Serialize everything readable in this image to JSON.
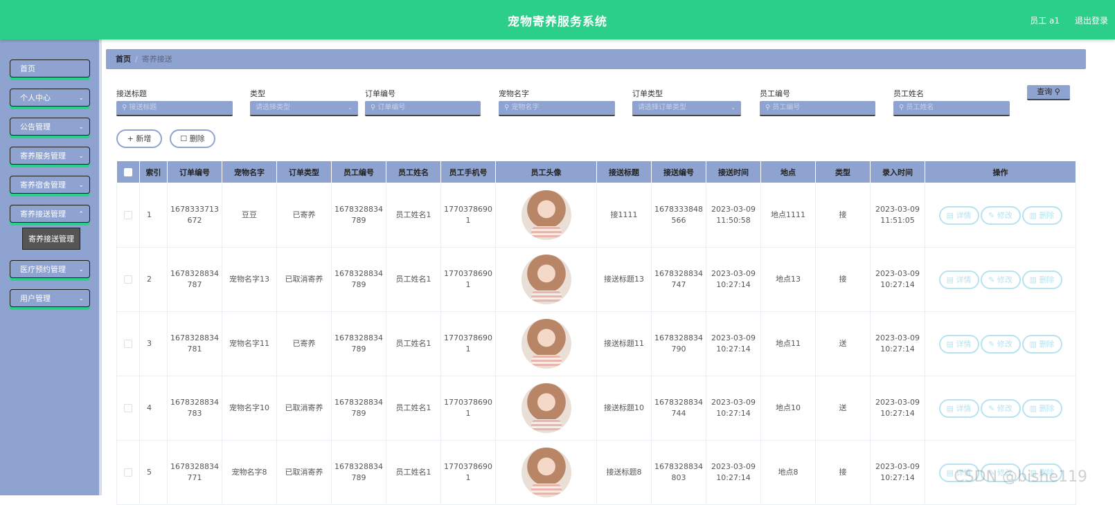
{
  "header": {
    "title": "宠物寄养服务系统",
    "user": "员工 a1",
    "logout": "退出登录"
  },
  "sidebar": {
    "items": [
      {
        "label": "首页",
        "chevron": false
      },
      {
        "label": "个人中心",
        "chevron": true
      },
      {
        "label": "公告管理",
        "chevron": true
      },
      {
        "label": "寄养服务管理",
        "chevron": true
      },
      {
        "label": "寄养宿舍管理",
        "chevron": true
      },
      {
        "label": "寄养接送管理",
        "chevron": true
      },
      {
        "label": "医疗预约管理",
        "chevron": true
      },
      {
        "label": "用户管理",
        "chevron": true
      }
    ],
    "submenu_label": "寄养接送管理"
  },
  "breadcrumb": {
    "home": "首页",
    "sep": "/",
    "current": "寄养接送"
  },
  "search": {
    "fields": [
      {
        "label": "接送标题",
        "placeholder": "接送标题",
        "type": "input"
      },
      {
        "label": "类型",
        "placeholder": "请选择类型",
        "type": "select"
      },
      {
        "label": "订单编号",
        "placeholder": "订单编号",
        "type": "input"
      },
      {
        "label": "宠物名字",
        "placeholder": "宠物名字",
        "type": "input"
      },
      {
        "label": "订单类型",
        "placeholder": "请选择订单类型",
        "type": "select"
      },
      {
        "label": "员工编号",
        "placeholder": "员工编号",
        "type": "input"
      },
      {
        "label": "员工姓名",
        "placeholder": "员工姓名",
        "type": "input"
      }
    ],
    "query_label": "查询"
  },
  "actions": {
    "add_label": "新增",
    "delete_label": "删除"
  },
  "table": {
    "headers": [
      "索引",
      "订单编号",
      "宠物名字",
      "订单类型",
      "员工编号",
      "员工姓名",
      "员工手机号",
      "员工头像",
      "接送标题",
      "接送编号",
      "接送时间",
      "地点",
      "类型",
      "录入时间",
      "操作"
    ],
    "action_labels": [
      "详情",
      "修改",
      "删除"
    ],
    "rows": [
      {
        "index": "1",
        "order_no": "1678333713672",
        "pet": "豆豆",
        "order_type": "已寄养",
        "emp_no": "1678328834789",
        "emp_name": "员工姓名1",
        "phone": "17703786901",
        "title": "接1111",
        "transfer_no": "1678333848566",
        "time": "2023-03-09 11:50:58",
        "place": "地点1111",
        "kind": "接",
        "created": "2023-03-09 11:51:05"
      },
      {
        "index": "2",
        "order_no": "1678328834787",
        "pet": "宠物名字13",
        "order_type": "已取消寄养",
        "emp_no": "1678328834789",
        "emp_name": "员工姓名1",
        "phone": "17703786901",
        "title": "接送标题13",
        "transfer_no": "1678328834747",
        "time": "2023-03-09 10:27:14",
        "place": "地点13",
        "kind": "接",
        "created": "2023-03-09 10:27:14"
      },
      {
        "index": "3",
        "order_no": "1678328834781",
        "pet": "宠物名字11",
        "order_type": "已寄养",
        "emp_no": "1678328834789",
        "emp_name": "员工姓名1",
        "phone": "17703786901",
        "title": "接送标题11",
        "transfer_no": "1678328834790",
        "time": "2023-03-09 10:27:14",
        "place": "地点11",
        "kind": "送",
        "created": "2023-03-09 10:27:14"
      },
      {
        "index": "4",
        "order_no": "1678328834783",
        "pet": "宠物名字10",
        "order_type": "已取消寄养",
        "emp_no": "1678328834789",
        "emp_name": "员工姓名1",
        "phone": "17703786901",
        "title": "接送标题10",
        "transfer_no": "1678328834744",
        "time": "2023-03-09 10:27:14",
        "place": "地点10",
        "kind": "送",
        "created": "2023-03-09 10:27:14"
      },
      {
        "index": "5",
        "order_no": "1678328834771",
        "pet": "宠物名字8",
        "order_type": "已取消寄养",
        "emp_no": "1678328834789",
        "emp_name": "员工姓名1",
        "phone": "17703786901",
        "title": "接送标题8",
        "transfer_no": "1678328834803",
        "time": "2023-03-09 10:27:14",
        "place": "地点8",
        "kind": "接",
        "created": "2023-03-09 10:27:14"
      }
    ]
  },
  "watermark": "CSDN @bishe119",
  "colors": {
    "header": "#2bcf89",
    "sidebar": "#8fa3d0",
    "action_border": "#b6e3ef"
  }
}
